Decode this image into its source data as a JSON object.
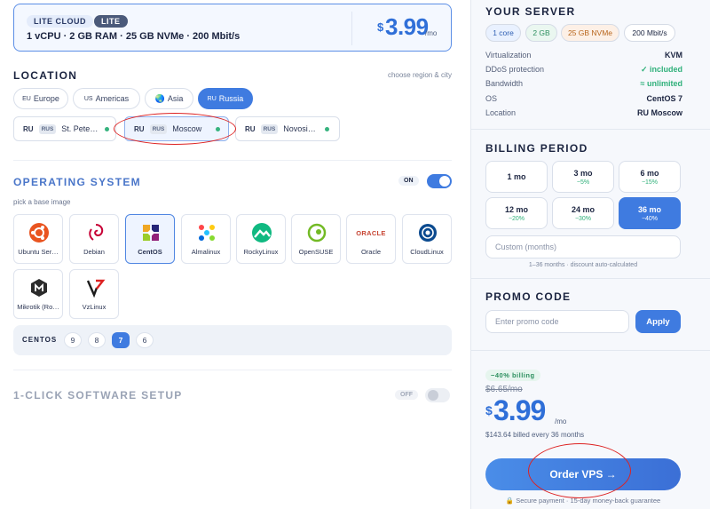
{
  "plan": {
    "badge": "LITE CLOUD",
    "tier": "LITE",
    "specs": "1 vCPU · 2 GB RAM · 25 GB NVMe · 200 Mbit/s",
    "currency": "$",
    "price": "3.99",
    "per": "/mo"
  },
  "location": {
    "title": "LOCATION",
    "hint": "choose region & city",
    "regions": [
      {
        "code": "EU",
        "label": "Europe"
      },
      {
        "code": "US",
        "label": "Americas"
      },
      {
        "code": "",
        "label": "Asia"
      },
      {
        "code": "RU",
        "label": "Russia"
      }
    ],
    "cities": [
      {
        "code": "RU",
        "tag": "RUS",
        "name": "St. Pete…"
      },
      {
        "code": "RU",
        "tag": "RUS",
        "name": "Moscow"
      },
      {
        "code": "RU",
        "tag": "RUS",
        "name": "Novosi…"
      }
    ]
  },
  "os": {
    "title": "OPERATING SYSTEM",
    "toggle_label": "ON",
    "subtitle": "pick a base image",
    "images": [
      "Ubuntu Ser…",
      "Debian",
      "CentOS",
      "Almalinux",
      "RockyLinux",
      "OpenSUSE",
      "Oracle",
      "CloudLinux",
      "Mikrotik (Ro…",
      "VzLinux"
    ],
    "oracle_logo_text": "ORACLE",
    "version_label": "CENTOS",
    "versions": [
      "9",
      "8",
      "7",
      "6"
    ]
  },
  "software": {
    "title": "1-CLICK SOFTWARE SETUP",
    "toggle_label": "OFF"
  },
  "server": {
    "title": "YOUR SERVER",
    "chips": [
      "1 core",
      "2 GB",
      "25 GB NVMe",
      "200 Mbit/s"
    ],
    "rows": [
      {
        "k": "Virtualization",
        "v": "KVM"
      },
      {
        "k": "DDoS protection",
        "v": "✓ included"
      },
      {
        "k": "Bandwidth",
        "v": "≈ unlimited"
      },
      {
        "k": "OS",
        "v": "CentOS 7"
      },
      {
        "k": "Location",
        "v": "RU Moscow"
      }
    ]
  },
  "billing": {
    "title": "BILLING PERIOD",
    "periods": [
      {
        "t": "1 mo",
        "d": ""
      },
      {
        "t": "3 mo",
        "d": "−5%"
      },
      {
        "t": "6 mo",
        "d": "−15%"
      },
      {
        "t": "12 mo",
        "d": "−20%"
      },
      {
        "t": "24 mo",
        "d": "−30%"
      },
      {
        "t": "36 mo",
        "d": "−40%"
      }
    ],
    "custom_placeholder": "Custom (months)",
    "note": "1–36 months · discount auto-calculated"
  },
  "promo": {
    "title": "PROMO CODE",
    "placeholder": "Enter promo code",
    "apply": "Apply"
  },
  "summary": {
    "discount_badge": "−40% billing",
    "old_price": "$6.65/mo",
    "currency": "$",
    "price": "3.99",
    "per": "/mo",
    "billed": "$143.64 billed every 36 months",
    "order": "Order VPS →",
    "guarantee": "🔒 Secure payment · 15-day money-back guarantee"
  },
  "colors": {
    "accent": "#3f7be0",
    "green": "#2fb07a",
    "annotation": "#d22222"
  }
}
